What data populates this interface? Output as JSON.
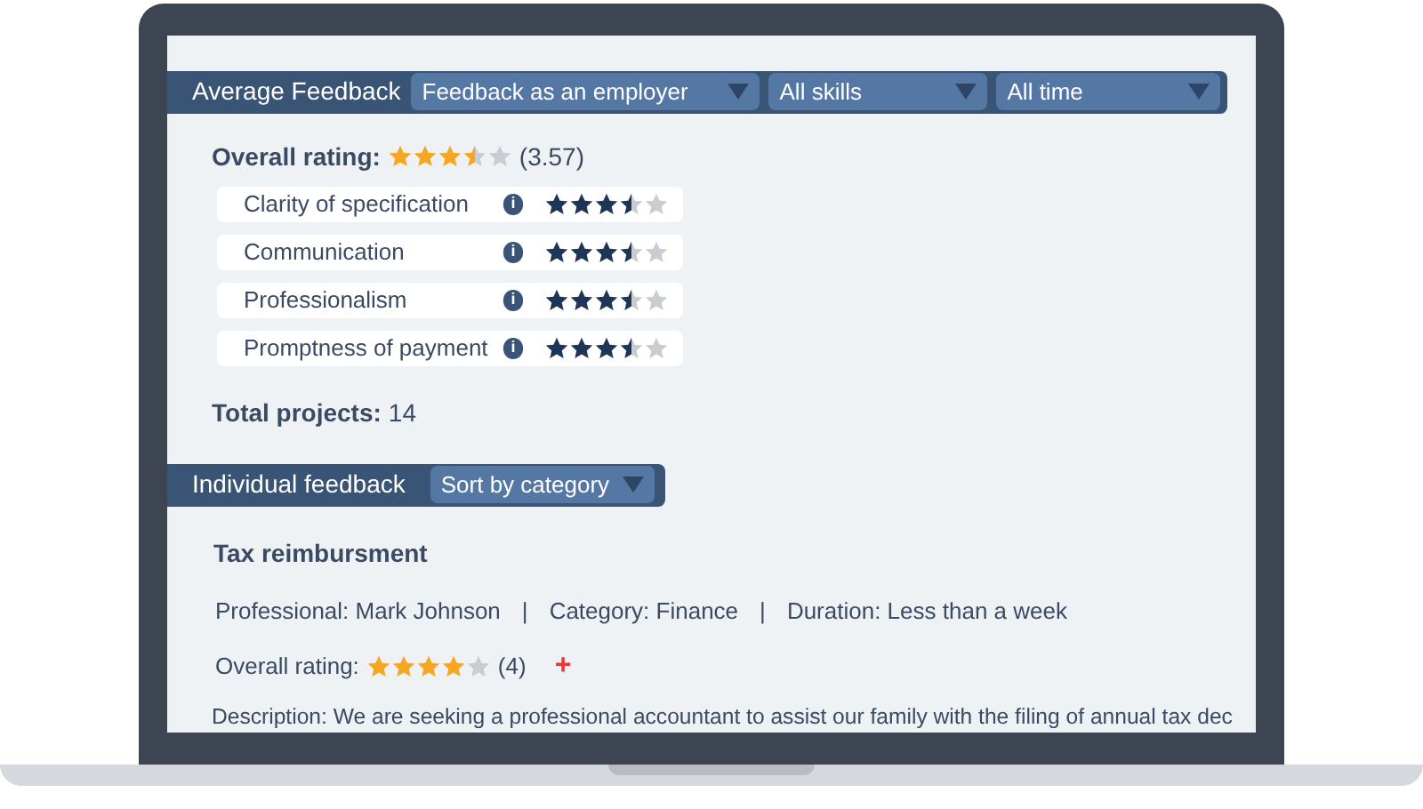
{
  "average_feedback": {
    "title": "Average Feedback",
    "filters": [
      {
        "value": "Feedback as an employer"
      },
      {
        "value": "All skills"
      },
      {
        "value": "All time"
      }
    ]
  },
  "overall_rating": {
    "label": "Overall rating:",
    "stars": 3.5,
    "score": "(3.57)"
  },
  "criteria": [
    {
      "label": "Clarity of specification",
      "info": "i",
      "stars": 3.5
    },
    {
      "label": "Communication",
      "info": "i",
      "stars": 3.5
    },
    {
      "label": "Professionalism",
      "info": "i",
      "stars": 3.5
    },
    {
      "label": "Promptness of payment",
      "info": "i",
      "stars": 3.5
    }
  ],
  "total_projects": {
    "label": "Total projects:",
    "value": "14"
  },
  "individual_feedback": {
    "title": "Individual feedback",
    "sort": {
      "value": "Sort by category"
    }
  },
  "feedback_items": [
    {
      "title": "Tax reimbursment",
      "details": [
        "Professional: Mark Johnson",
        "|",
        "Category: Finance",
        "|",
        "Duration: Less than a week"
      ],
      "rating_label": "Overall rating:",
      "stars": 4,
      "score": "(4)",
      "add": "+",
      "description": "Description: We are seeking a professional accountant to assist our family with the filing of annual tax dec"
    }
  ]
}
